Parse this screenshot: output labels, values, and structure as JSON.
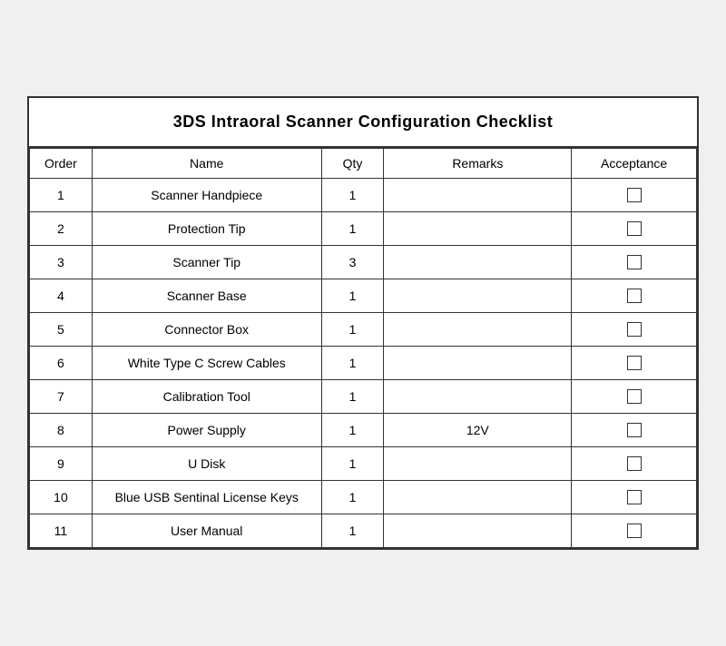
{
  "title": "3DS Intraoral Scanner Configuration Checklist",
  "columns": {
    "order": "Order",
    "name": "Name",
    "qty": "Qty",
    "remarks": "Remarks",
    "acceptance": "Acceptance"
  },
  "rows": [
    {
      "order": "1",
      "name": "Scanner Handpiece",
      "qty": "1",
      "remarks": ""
    },
    {
      "order": "2",
      "name": "Protection Tip",
      "qty": "1",
      "remarks": ""
    },
    {
      "order": "3",
      "name": "Scanner Tip",
      "qty": "3",
      "remarks": ""
    },
    {
      "order": "4",
      "name": "Scanner Base",
      "qty": "1",
      "remarks": ""
    },
    {
      "order": "5",
      "name": "Connector Box",
      "qty": "1",
      "remarks": ""
    },
    {
      "order": "6",
      "name": "White Type C Screw Cables",
      "qty": "1",
      "remarks": ""
    },
    {
      "order": "7",
      "name": "Calibration Tool",
      "qty": "1",
      "remarks": ""
    },
    {
      "order": "8",
      "name": "Power Supply",
      "qty": "1",
      "remarks": "12V"
    },
    {
      "order": "9",
      "name": "U Disk",
      "qty": "1",
      "remarks": ""
    },
    {
      "order": "10",
      "name": "Blue USB Sentinal License Keys",
      "qty": "1",
      "remarks": ""
    },
    {
      "order": "11",
      "name": "User Manual",
      "qty": "1",
      "remarks": ""
    }
  ]
}
